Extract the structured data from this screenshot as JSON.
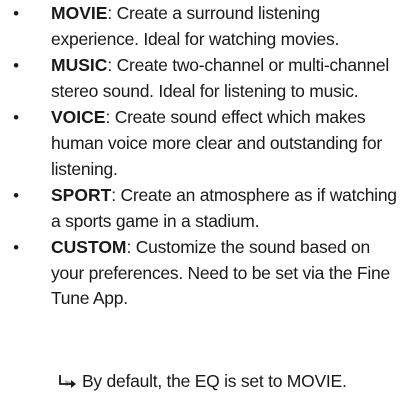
{
  "modes": [
    {
      "name": "MOVIE",
      "description": ": Create a surround listening experience. Ideal for watching movies."
    },
    {
      "name": "MUSIC",
      "description": ": Create two-channel or multi-channel stereo sound. Ideal for listening to music."
    },
    {
      "name": "VOICE",
      "description": ": Create sound effect which makes human voice more clear and outstanding for listening."
    },
    {
      "name": "SPORT",
      "description": ": Create an atmosphere as if watching a sports game in a stadium."
    },
    {
      "name": "CUSTOM",
      "description": ": Customize the sound based on your preferences. Need to be set via the Fine Tune App."
    }
  ],
  "bullet_glyph": "•",
  "note": {
    "icon": "return-arrow-icon",
    "text": "By default, the EQ is set to MOVIE."
  }
}
